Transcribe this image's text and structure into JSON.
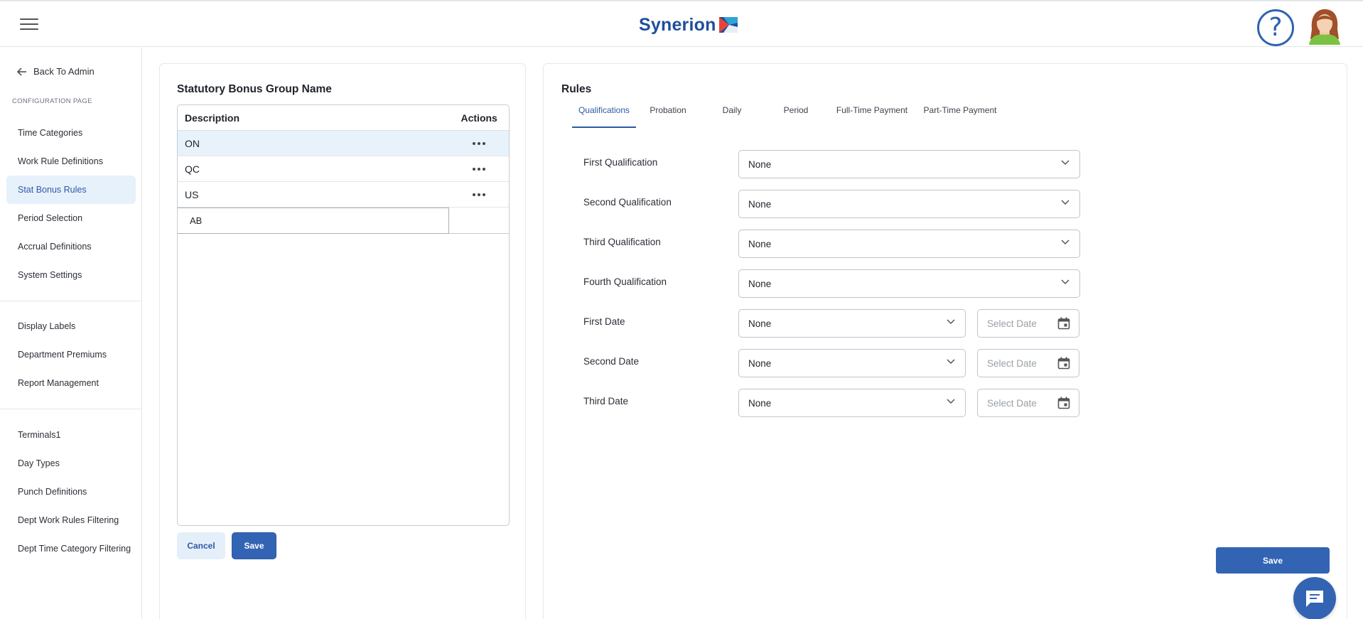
{
  "header": {
    "brand_name": "Synerion",
    "help_symbol": "?",
    "icons": [
      "hamburger-icon",
      "help-icon",
      "avatar"
    ]
  },
  "sidebar": {
    "back_label": "Back To Admin",
    "section_label": "CONFIGURATION PAGE",
    "groups": [
      [
        "Time Categories",
        "Work Rule Definitions",
        "Stat Bonus Rules",
        "Period Selection",
        "Accrual Definitions",
        "System Settings"
      ],
      [
        "Display Labels",
        "Department Premiums",
        "Report Management"
      ],
      [
        "Terminals1",
        "Day Types",
        "Punch Definitions",
        "Dept Work Rules Filtering",
        "Dept Time Category Filtering"
      ]
    ],
    "active_item": "Stat Bonus Rules"
  },
  "left_panel": {
    "title": "Statutory Bonus Group Name",
    "columns": [
      "Description",
      "Actions"
    ],
    "rows": [
      {
        "description": "ON",
        "selected": true
      },
      {
        "description": "QC",
        "selected": false
      },
      {
        "description": "US",
        "selected": false
      }
    ],
    "new_row_value": "AB",
    "cancel_label": "Cancel",
    "save_label": "Save"
  },
  "right_panel": {
    "title": "Rules",
    "tabs": [
      "Qualifications",
      "Probation",
      "Daily",
      "Period",
      "Full-Time Payment",
      "Part-Time Payment"
    ],
    "active_tab": "Qualifications",
    "fields": [
      {
        "label": "First Qualification",
        "value": "None"
      },
      {
        "label": "Second Qualification",
        "value": "None"
      },
      {
        "label": "Third Qualification",
        "value": "None"
      },
      {
        "label": "Fourth Qualification",
        "value": "None"
      },
      {
        "label": "First Date",
        "value": "None",
        "date_placeholder": "Select Date"
      },
      {
        "label": "Second Date",
        "value": "None",
        "date_placeholder": "Select Date"
      },
      {
        "label": "Third Date",
        "value": "None",
        "date_placeholder": "Select Date"
      }
    ],
    "save_label": "Save"
  },
  "colors": {
    "brand_blue": "#1e4f9c",
    "primary_button": "#3364b4",
    "active_nav_bg": "#e7f1fb",
    "selected_row_bg": "#e8f2fb"
  }
}
